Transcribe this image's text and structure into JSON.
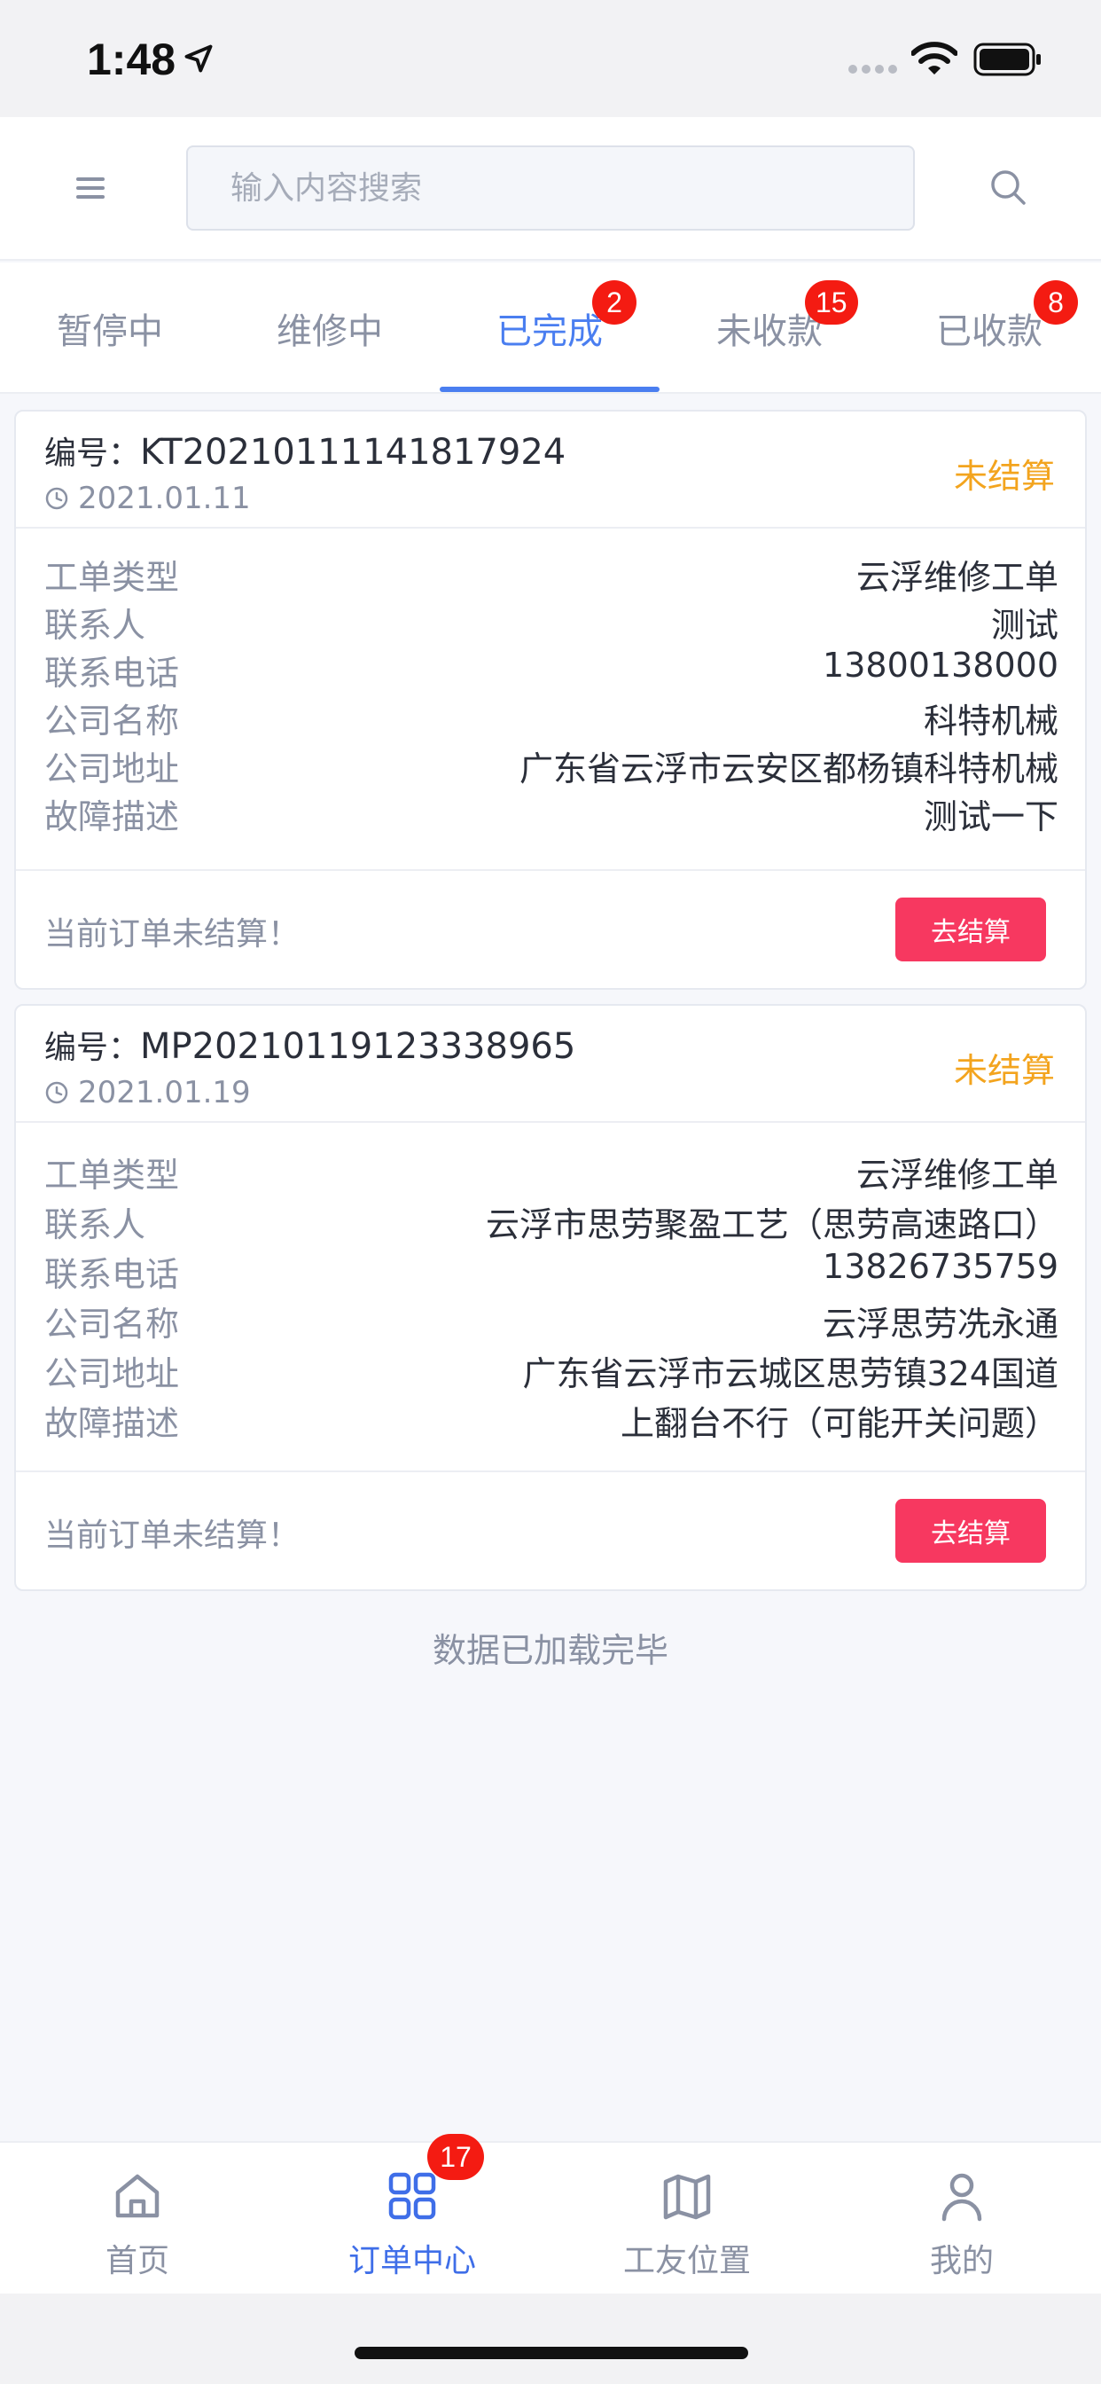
{
  "status_bar": {
    "time": "1:48"
  },
  "search": {
    "placeholder": "输入内容搜索"
  },
  "tabs": [
    {
      "label": "暂停中",
      "badge": null,
      "active": false
    },
    {
      "label": "维修中",
      "badge": null,
      "active": false
    },
    {
      "label": "已完成",
      "badge": "2",
      "active": true
    },
    {
      "label": "未收款",
      "badge": "15",
      "active": false
    },
    {
      "label": "已收款",
      "badge": "8",
      "active": false
    }
  ],
  "orders": [
    {
      "no_label": "编号：",
      "no": "KT20210111141817924",
      "date": "2021.01.11",
      "status": "未结算",
      "fields": [
        {
          "key": "工单类型",
          "value": "云浮维修工单"
        },
        {
          "key": "联系人",
          "value": "测试"
        },
        {
          "key": "联系电话",
          "value": "13800138000"
        },
        {
          "key": "公司名称",
          "value": "科特机械"
        },
        {
          "key": "公司地址",
          "value": "广东省云浮市云安区都杨镇科特机械"
        },
        {
          "key": "故障描述",
          "value": "测试一下"
        }
      ],
      "foot_text": "当前订单未结算！",
      "button_label": "去结算"
    },
    {
      "no_label": "编号：",
      "no": "MP20210119123338965",
      "date": "2021.01.19",
      "status": "未结算",
      "fields": [
        {
          "key": "工单类型",
          "value": "云浮维修工单"
        },
        {
          "key": "联系人",
          "value": "云浮市思劳聚盈工艺（思劳高速路口）"
        },
        {
          "key": "联系电话",
          "value": "13826735759"
        },
        {
          "key": "公司名称",
          "value": "云浮思劳冼永通"
        },
        {
          "key": "公司地址",
          "value": "广东省云浮市云城区思劳镇324国道"
        },
        {
          "key": "故障描述",
          "value": "上翻台不行（可能开关问题）"
        }
      ],
      "foot_text": "当前订单未结算！",
      "button_label": "去结算"
    }
  ],
  "loaded_text": "数据已加载完毕",
  "bottom_nav": [
    {
      "label": "首页",
      "icon": "home-icon",
      "badge": null,
      "active": false
    },
    {
      "label": "订单中心",
      "icon": "grid-icon",
      "badge": "17",
      "active": true
    },
    {
      "label": "工友位置",
      "icon": "map-icon",
      "badge": null,
      "active": false
    },
    {
      "label": "我的",
      "icon": "person-icon",
      "badge": null,
      "active": false
    }
  ],
  "colors": {
    "accent": "#4a7ef0",
    "badge": "#f41b12",
    "status_warn": "#f3a41e",
    "pay_button": "#f73860"
  }
}
